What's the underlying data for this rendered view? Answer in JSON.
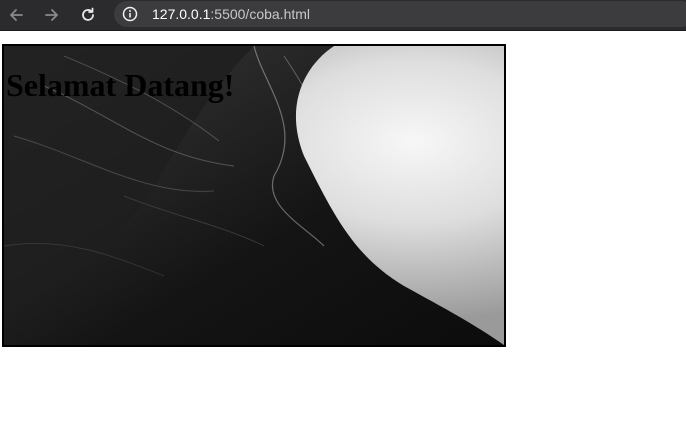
{
  "browser": {
    "url_host": "127.0.0.1",
    "url_rest": ":5500/coba.html",
    "back_icon": "arrow-left-icon",
    "forward_icon": "arrow-right-icon",
    "reload_icon": "reload-icon",
    "site_info_icon": "info-icon"
  },
  "page": {
    "heading": "Selamat Datang!",
    "hero_image": "black-and-white photo of a person's hair and shoulder"
  }
}
